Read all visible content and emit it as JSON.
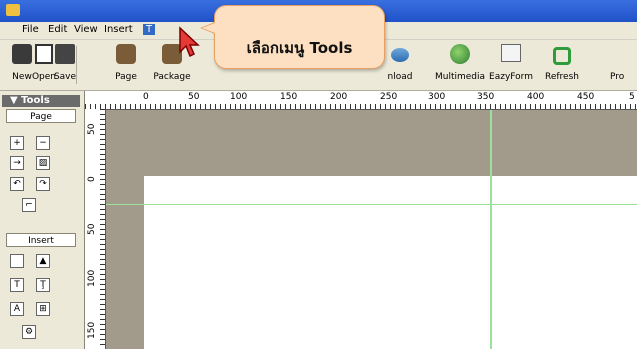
{
  "menubar": {
    "items": [
      {
        "label": "File"
      },
      {
        "label": "Edit"
      },
      {
        "label": "View"
      },
      {
        "label": "Insert"
      },
      {
        "label": "T"
      }
    ]
  },
  "toolbar": {
    "buttons": [
      {
        "label": "New",
        "icon": "new-icon"
      },
      {
        "label": "Open",
        "icon": "open-icon"
      },
      {
        "label": "Save",
        "icon": "save-icon"
      },
      {
        "label": "Page",
        "icon": "page-icon"
      },
      {
        "label": "Package",
        "icon": "package-icon"
      },
      {
        "label": "nload",
        "icon": "download-icon"
      },
      {
        "label": "Multimedia",
        "icon": "multimedia-icon"
      },
      {
        "label": "EazyForm",
        "icon": "eazyform-icon"
      },
      {
        "label": "Refresh",
        "icon": "refresh-icon"
      },
      {
        "label": "Pro",
        "icon": "pro-icon"
      }
    ]
  },
  "left_panel": {
    "header": "▼ Tools",
    "sections": [
      {
        "label": "Page"
      },
      {
        "label": "Insert"
      }
    ]
  },
  "ruler": {
    "h_ticks": [
      "0",
      "50",
      "100",
      "150",
      "200",
      "250",
      "300",
      "350",
      "400",
      "450",
      "5"
    ],
    "v_ticks": [
      "50",
      "0",
      "50",
      "100",
      "150"
    ]
  },
  "callout": {
    "text": "เลือกเมนู Tools"
  },
  "colors": {
    "titlebar": "#2a5ed8",
    "callout_bg": "#fde0c2",
    "canvas_bg": "#a29b8c",
    "guide": "#9be09b"
  }
}
